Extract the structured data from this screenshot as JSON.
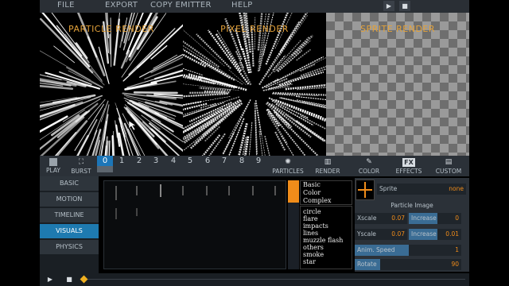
{
  "menu": {
    "items": [
      "FILE",
      "EXPORT",
      "COPY EMITTER",
      "HELP"
    ],
    "play_icon": "▶",
    "stop_icon": "■"
  },
  "panels": {
    "particle": "PARTICLE RENDER",
    "pixel": "PIXEL RENDER",
    "sprite": "SPRITE RENDER"
  },
  "toolbar": {
    "play": "PLAY",
    "burst": "BURST",
    "numbers": [
      "0",
      "1",
      "2",
      "3",
      "4",
      "5",
      "6",
      "7",
      "8",
      "9"
    ],
    "active_number": "0",
    "tools": [
      {
        "label": "PARTICLES",
        "icon": "gear-icon",
        "glyph": "✺"
      },
      {
        "label": "RENDER",
        "icon": "book-icon",
        "glyph": "▥"
      },
      {
        "label": "COLOR",
        "icon": "brush-icon",
        "glyph": "✎"
      },
      {
        "label": "EFFECTS",
        "icon": "fx-icon",
        "glyph": "FX"
      },
      {
        "label": "CUSTOM",
        "icon": "document-icon",
        "glyph": "▤"
      }
    ]
  },
  "nav": {
    "items": [
      "BASIC",
      "MOTION",
      "TIMELINE",
      "VISUALS",
      "PHYSICS"
    ],
    "active": "VISUALS"
  },
  "types": [
    "Basic",
    "Color",
    "Complex"
  ],
  "styles": [
    "circle",
    "flare",
    "impacts",
    "lines",
    "muzzle flash",
    "others",
    "smoke",
    "star"
  ],
  "props": {
    "sprite_label": "Sprite",
    "sprite_value": "none",
    "section_title": "Particle Image",
    "xscale_label": "Xscale",
    "xscale_value": "0.07",
    "xinc_label": "Increase",
    "xinc_value": "0",
    "yscale_label": "Yscale",
    "yscale_value": "0.07",
    "yinc_label": "Increase",
    "yinc_value": "0.01",
    "anim_label": "Anim. Speed",
    "anim_value": "1",
    "rotate_label": "Rotate",
    "rotate_value": "90"
  },
  "colors": {
    "accent_orange": "#f08c1a",
    "active_blue": "#1e7ab0",
    "title_gold": "#e4a23a"
  }
}
